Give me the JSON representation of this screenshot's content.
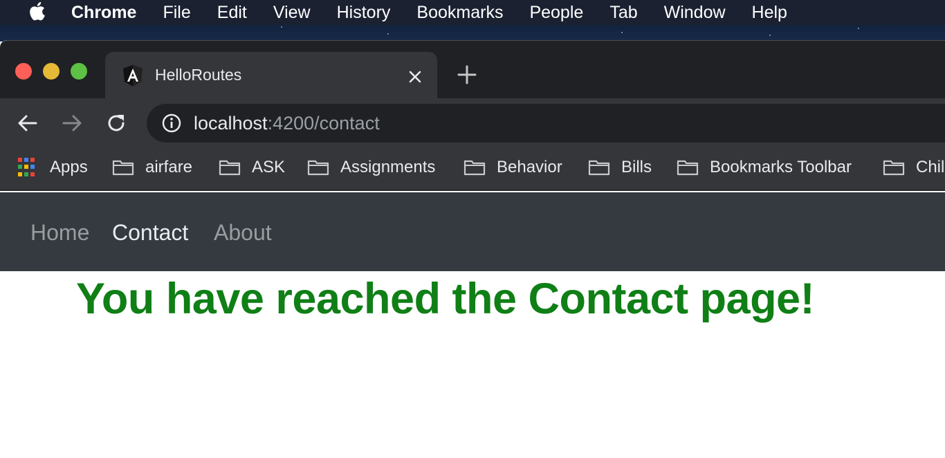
{
  "menubar": {
    "items": [
      "Chrome",
      "File",
      "Edit",
      "View",
      "History",
      "Bookmarks",
      "People",
      "Tab",
      "Window",
      "Help"
    ]
  },
  "tab": {
    "title": "HelloRoutes",
    "favicon": "angular-icon"
  },
  "omnibox": {
    "host": "localhost",
    "rest": ":4200/contact"
  },
  "bookmarks": {
    "items": [
      "Apps",
      "airfare",
      "ASK",
      "Assignments",
      "Behavior",
      "Bills",
      "Bookmarks Toolbar",
      "Chil"
    ]
  },
  "page": {
    "nav": {
      "home": "Home",
      "contact": "Contact",
      "about": "About"
    },
    "heading": "You have reached the Contact page!"
  },
  "colors": {
    "traffic_red": "#fe5f57",
    "traffic_yellow": "#e6b937",
    "traffic_green": "#5cc144",
    "heading": "#0f7f16",
    "navbar": "#343a40"
  }
}
